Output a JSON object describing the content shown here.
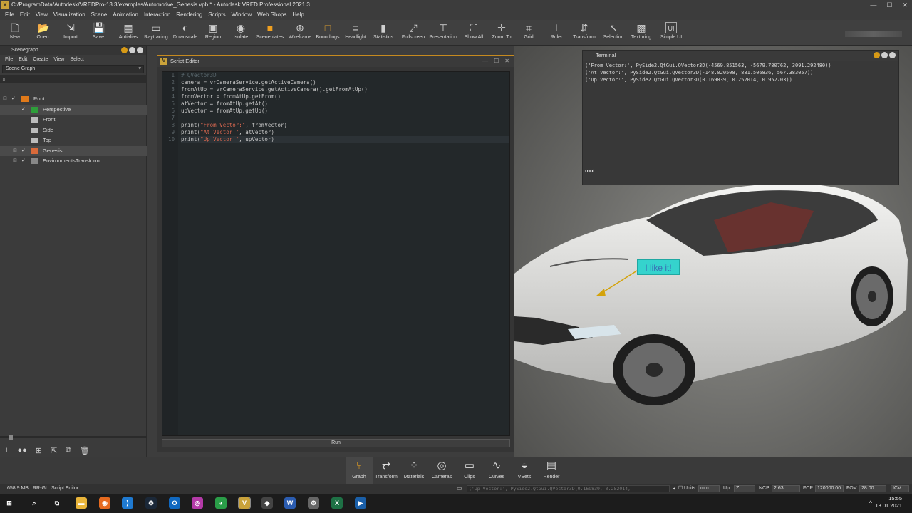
{
  "window": {
    "title": "C:/ProgramData/Autodesk/VREDPro-13.3/examples/Automotive_Genesis.vpb * - Autodesk VRED Professional 2021.3",
    "logo": "V"
  },
  "window_controls": {
    "minimize": "—",
    "maximize": "☐",
    "close": "✕"
  },
  "menu": [
    "File",
    "Edit",
    "View",
    "Visualization",
    "Scene",
    "Animation",
    "Interaction",
    "Rendering",
    "Scripts",
    "Window",
    "Web Shops",
    "Help"
  ],
  "toolbar": [
    {
      "label": "New",
      "icon": "new-icon",
      "glyph": "🗋"
    },
    {
      "label": "Open",
      "icon": "open-folder-icon",
      "glyph": "📂"
    },
    {
      "label": "Import",
      "icon": "import-icon",
      "glyph": "⇲"
    },
    {
      "label": "Save",
      "icon": "save-icon",
      "glyph": "💾"
    },
    {
      "label": "Antialias",
      "icon": "antialias-icon",
      "glyph": "▦"
    },
    {
      "label": "Raytracing",
      "icon": "raytracing-icon",
      "glyph": "▭"
    },
    {
      "label": "Downscale",
      "icon": "downscale-icon",
      "glyph": "◐"
    },
    {
      "label": "Region",
      "icon": "region-icon",
      "glyph": "▣"
    },
    {
      "label": "Isolate",
      "icon": "isolate-icon",
      "glyph": "◉"
    },
    {
      "label": "Sceneplates",
      "icon": "sceneplates-icon",
      "glyph": "■"
    },
    {
      "label": "Wireframe",
      "icon": "wireframe-icon",
      "glyph": "⊕"
    },
    {
      "label": "Boundings",
      "icon": "boundings-icon",
      "glyph": "□"
    },
    {
      "label": "Headlight",
      "icon": "headlight-icon",
      "glyph": "≡"
    },
    {
      "label": "Statistics",
      "icon": "statistics-icon",
      "glyph": "▮"
    },
    {
      "label": "Fullscreen",
      "icon": "fullscreen-icon",
      "glyph": "⤢"
    },
    {
      "label": "Presentation",
      "icon": "presentation-icon",
      "glyph": "⊤"
    },
    {
      "label": "Show All",
      "icon": "show-all-icon",
      "glyph": "⛶"
    },
    {
      "label": "Zoom To",
      "icon": "zoom-to-icon",
      "glyph": "✛"
    },
    {
      "label": "Grid",
      "icon": "grid-icon",
      "glyph": "⌗"
    },
    {
      "label": "Ruler",
      "icon": "ruler-icon",
      "glyph": "⊥"
    },
    {
      "label": "Transform",
      "icon": "transform-icon",
      "glyph": "⇵"
    },
    {
      "label": "Selection",
      "icon": "selection-icon",
      "glyph": "↖"
    },
    {
      "label": "Texturing",
      "icon": "texturing-icon",
      "glyph": "▩"
    },
    {
      "label": "Simple UI",
      "icon": "simple-ui-icon",
      "glyph": "UI"
    }
  ],
  "scenegraph": {
    "title": "Scenegraph",
    "menu": [
      "File",
      "Edit",
      "Create",
      "View",
      "Select"
    ],
    "combo": "Scene Graph",
    "tree": [
      {
        "label": "Root",
        "checked": "✓",
        "selected": false,
        "indent": 0
      },
      {
        "label": "Perspective",
        "checked": "✓",
        "selected": true,
        "indent": 1
      },
      {
        "label": "Front",
        "checked": "",
        "selected": false,
        "indent": 1
      },
      {
        "label": "Side",
        "checked": "",
        "selected": false,
        "indent": 1
      },
      {
        "label": "Top",
        "checked": "",
        "selected": false,
        "indent": 1
      },
      {
        "label": "Genesis",
        "checked": "✓",
        "selected": true,
        "indent": 1
      },
      {
        "label": "EnvironmentsTransform",
        "checked": "✓",
        "selected": false,
        "indent": 1
      }
    ],
    "bottom_icons": [
      "+",
      "●●",
      "⊞",
      "⇱",
      "⧉",
      "🗑"
    ]
  },
  "script_editor": {
    "title": "Script Editor",
    "lines": [
      {
        "n": "1",
        "t": "# QVector3D",
        "kind": "comment"
      },
      {
        "n": "2",
        "t": "camera = vrCameraService.getActiveCamera()",
        "kind": "code"
      },
      {
        "n": "3",
        "t": "fromAtUp = vrCameraService.getActiveCamera().getFromAtUp()",
        "kind": "code"
      },
      {
        "n": "4",
        "t": "fromVector = fromAtUp.getFrom()",
        "kind": "code"
      },
      {
        "n": "5",
        "t": "atVector = fromAtUp.getAt()",
        "kind": "code"
      },
      {
        "n": "6",
        "t": "upVector = fromAtUp.getUp()",
        "kind": "code"
      },
      {
        "n": "7",
        "t": "",
        "kind": "code"
      },
      {
        "n": "8",
        "pre": "print(",
        "str": "\"From Vector:\"",
        "post": ", fromVector)",
        "kind": "print"
      },
      {
        "n": "9",
        "pre": "print(",
        "str": "\"At Vector:\"",
        "post": ", atVector)",
        "kind": "print"
      },
      {
        "n": "10",
        "pre": "print(",
        "str": "\"Up Vector:\"",
        "post": ", upVector)",
        "kind": "print"
      }
    ],
    "run_label": "Run"
  },
  "terminal": {
    "title": "Terminal",
    "output": [
      "('From Vector:', PySide2.QtGui.QVector3D(-4569.851563, -5679.780762, 3091.292480))",
      "('At Vector:', PySide2.QtGui.QVector3D(-148.020508, 881.506836, 567.383057))",
      "('Up Vector:', PySide2.QtGui.QVector3D(0.169839, 0.252014, 0.952703))"
    ],
    "prompt": "root:"
  },
  "viewport": {
    "annotation": "I like it!"
  },
  "modules": [
    {
      "label": "Graph",
      "glyph": "⑂",
      "icon": "graph-icon",
      "active": true
    },
    {
      "label": "Transform",
      "glyph": "⇄",
      "icon": "transform-module-icon",
      "active": false
    },
    {
      "label": "Materials",
      "glyph": "⁘",
      "icon": "materials-icon",
      "active": false
    },
    {
      "label": "Cameras",
      "glyph": "◎",
      "icon": "cameras-icon",
      "active": false
    },
    {
      "label": "Clips",
      "glyph": "▭",
      "icon": "clips-icon",
      "active": false
    },
    {
      "label": "Curves",
      "glyph": "∿",
      "icon": "curves-icon",
      "active": false
    },
    {
      "label": "VSets",
      "glyph": "◒",
      "icon": "vsets-icon",
      "active": false
    },
    {
      "label": "Render",
      "glyph": "▤",
      "icon": "render-icon",
      "active": false
    }
  ],
  "status": {
    "memory": "658.9 MB",
    "renderer": "RR-GL",
    "module": "Script Editor",
    "message": "('Up Vector:', PySide2.QtGui.QVector3D(0.169839, 0.252014,",
    "units_label": "Units",
    "units": "mm",
    "up_label": "Up",
    "up": "Z",
    "ncp_label": "NCP",
    "ncp": "2.63",
    "fcp_label": "FCP",
    "fcp": "120000.00",
    "fov_label": "FOV",
    "fov": "28.00",
    "icv": "ICV"
  },
  "taskbar": {
    "apps": [
      {
        "name": "windows-start-icon",
        "glyph": "⊞",
        "color": "#1c1c1c"
      },
      {
        "name": "search-icon",
        "glyph": "⌕",
        "color": "#1c1c1c"
      },
      {
        "name": "task-view-icon",
        "glyph": "⧉",
        "color": "#1c1c1c"
      },
      {
        "name": "file-explorer-icon",
        "glyph": "▬",
        "color": "#e8b43a"
      },
      {
        "name": "firefox-icon",
        "glyph": "◉",
        "color": "#e66a1f"
      },
      {
        "name": "vscode-icon",
        "glyph": "⟩",
        "color": "#1f7ad1"
      },
      {
        "name": "steam-icon",
        "glyph": "⚙",
        "color": "#1b2838"
      },
      {
        "name": "outlook-icon",
        "glyph": "O",
        "color": "#1068c0"
      },
      {
        "name": "media-icon",
        "glyph": "◎",
        "color": "#b43aa8"
      },
      {
        "name": "chrome-icon",
        "glyph": "◕",
        "color": "#2a9d48"
      },
      {
        "name": "vred-icon",
        "glyph": "V",
        "color": "#c9a23a"
      },
      {
        "name": "git-icon",
        "glyph": "◆",
        "color": "#444444"
      },
      {
        "name": "word-icon",
        "glyph": "W",
        "color": "#2b5cb0"
      },
      {
        "name": "app-icon",
        "glyph": "⚙",
        "color": "#666666"
      },
      {
        "name": "excel-icon",
        "glyph": "X",
        "color": "#1e7145"
      },
      {
        "name": "presentation-app-icon",
        "glyph": "▶",
        "color": "#1a5fa8"
      }
    ],
    "time": "15:55",
    "date": "13.01.2021"
  },
  "colors": {
    "accent": "#c68a1f",
    "callout": "#35d3cd",
    "selected_row": "#4a4a4a"
  }
}
